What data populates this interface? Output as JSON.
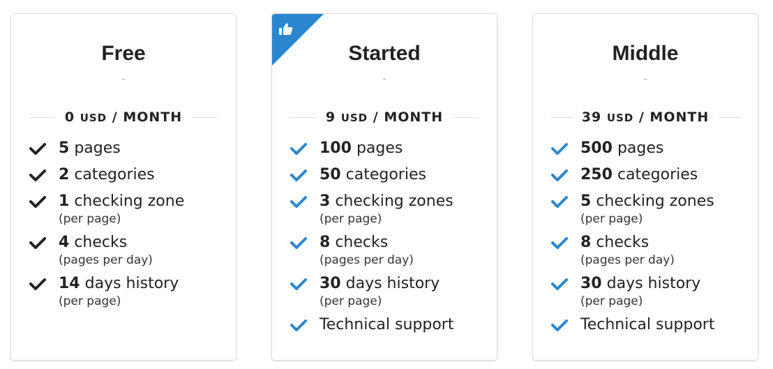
{
  "colors": {
    "accent": "#2b86cf",
    "check_default": "#222222",
    "text": "#222222"
  },
  "plans": [
    {
      "name": "Free",
      "subtitle": "-",
      "price_amount": "0",
      "price_currency": "USD",
      "price_period": "/ MONTH",
      "featured": false,
      "check_icon": "check-icon",
      "features": [
        {
          "value": "5",
          "label": "pages",
          "note": ""
        },
        {
          "value": "2",
          "label": "categories",
          "note": ""
        },
        {
          "value": "1",
          "label": "checking zone",
          "note": "(per page)"
        },
        {
          "value": "4",
          "label": "checks",
          "note": "(pages per day)"
        },
        {
          "value": "14",
          "label": "days history",
          "note": "(per page)"
        }
      ]
    },
    {
      "name": "Started",
      "subtitle": "-",
      "price_amount": "9",
      "price_currency": "USD",
      "price_period": "/ MONTH",
      "featured": true,
      "badge_icon": "thumbs-up-icon",
      "check_icon": "check-icon",
      "features": [
        {
          "value": "100",
          "label": "pages",
          "note": ""
        },
        {
          "value": "50",
          "label": "categories",
          "note": ""
        },
        {
          "value": "3",
          "label": "checking zones",
          "note": "(per page)"
        },
        {
          "value": "8",
          "label": "checks",
          "note": "(pages per day)"
        },
        {
          "value": "30",
          "label": "days history",
          "note": "(per page)"
        },
        {
          "value": "",
          "label": "Technical support",
          "note": ""
        }
      ]
    },
    {
      "name": "Middle",
      "subtitle": "-",
      "price_amount": "39",
      "price_currency": "USD",
      "price_period": "/ MONTH",
      "featured": false,
      "check_icon": "check-icon",
      "features": [
        {
          "value": "500",
          "label": "pages",
          "note": ""
        },
        {
          "value": "250",
          "label": "categories",
          "note": ""
        },
        {
          "value": "5",
          "label": "checking zones",
          "note": "(per page)"
        },
        {
          "value": "8",
          "label": "checks",
          "note": "(pages per day)"
        },
        {
          "value": "30",
          "label": "days history",
          "note": "(per page)"
        },
        {
          "value": "",
          "label": "Technical support",
          "note": ""
        }
      ]
    }
  ]
}
